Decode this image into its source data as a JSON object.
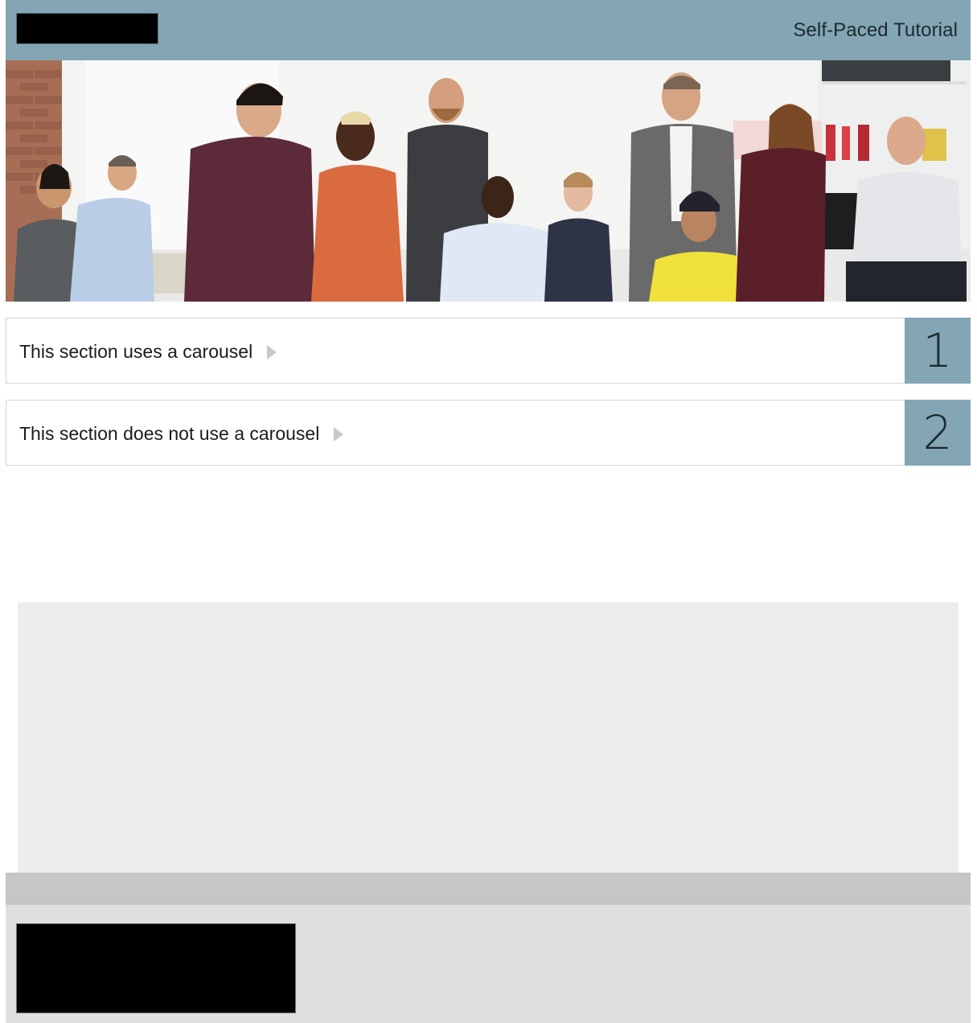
{
  "header": {
    "title": "Self-Paced Tutorial",
    "color": "#84a5b3"
  },
  "hero": {
    "icon": "team-photo"
  },
  "sections": [
    {
      "label": "This section uses a carousel",
      "number": "1"
    },
    {
      "label": "This section does not use a carousel",
      "number": "2"
    }
  ]
}
